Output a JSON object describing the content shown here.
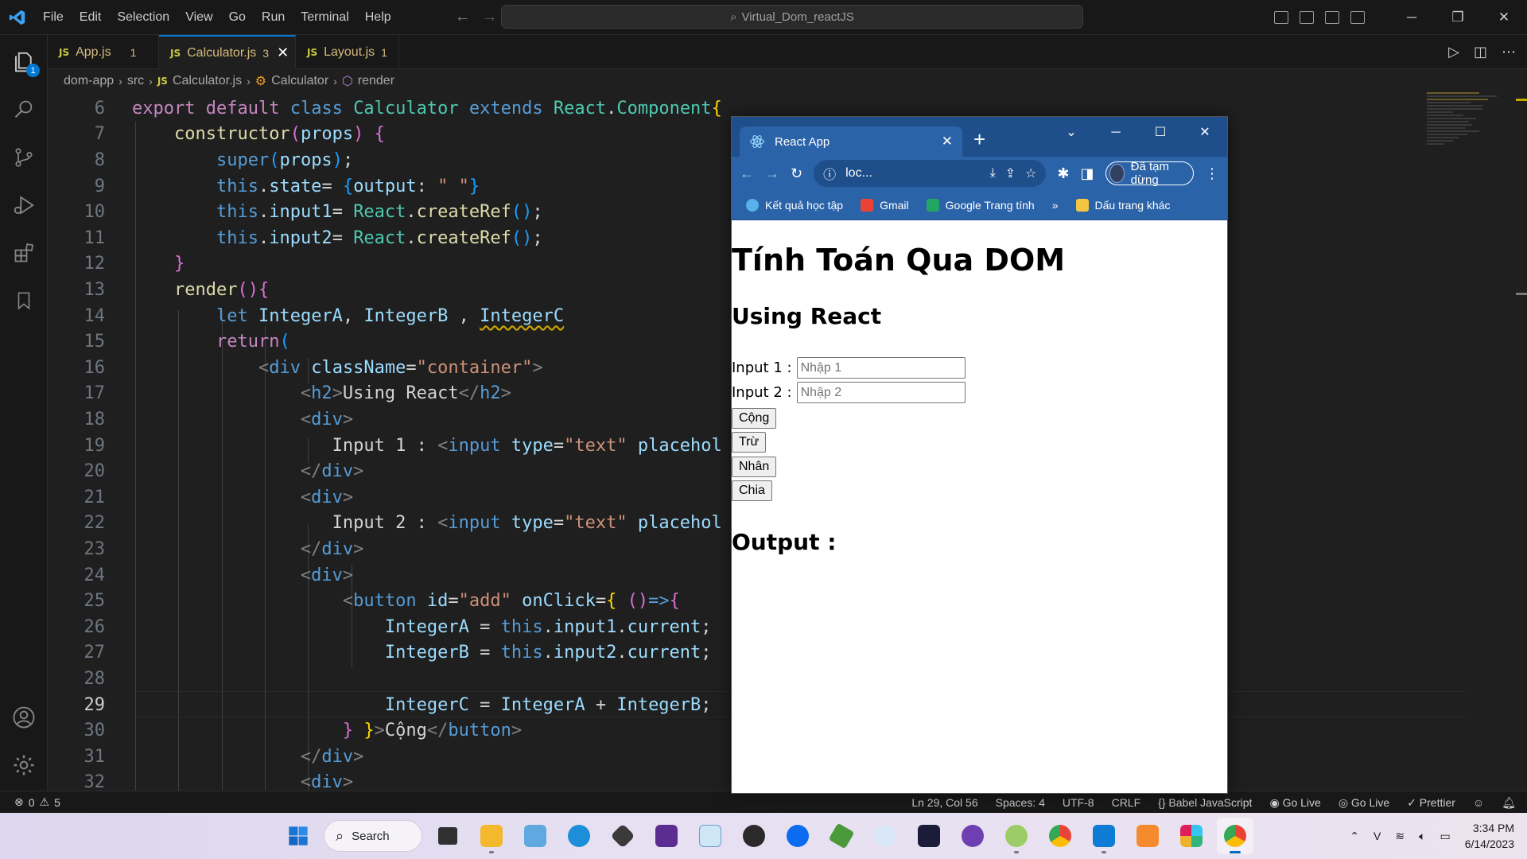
{
  "vscode": {
    "menu": [
      "File",
      "Edit",
      "Selection",
      "View",
      "Go",
      "Run",
      "Terminal",
      "Help"
    ],
    "search_text": "Virtual_Dom_reactJS",
    "explorer_badge": "1",
    "tabs": [
      {
        "label": "App.js",
        "badge": "JS",
        "count": "1",
        "modified": true,
        "active": false
      },
      {
        "label": "Calculator.js",
        "badge": "JS",
        "count": "3",
        "modified": false,
        "active": true
      },
      {
        "label": "Layout.js",
        "badge": "JS",
        "count": "1",
        "modified": false,
        "active": false
      }
    ],
    "breadcrumb": [
      "dom-app",
      "src",
      "Calculator.js",
      "Calculator",
      "render"
    ],
    "current_line": 29,
    "line_numbers": [
      "6",
      "7",
      "8",
      "9",
      "10",
      "11",
      "12",
      "13",
      "14",
      "15",
      "16",
      "17",
      "18",
      "19",
      "20",
      "21",
      "22",
      "23",
      "24",
      "25",
      "26",
      "27",
      "28",
      "29",
      "30",
      "31",
      "32"
    ],
    "status": {
      "errors": "0",
      "warnings": "5",
      "position": "Ln 29, Col 56",
      "spaces": "Spaces: 4",
      "encoding": "UTF-8",
      "eol": "CRLF",
      "language": "Babel JavaScript",
      "golive1": "Go Live",
      "golive2": "Go Live",
      "prettier": "Prettier"
    }
  },
  "code_text": {
    "l6_export": "export",
    "l6_default": "default",
    "l6_class": "class",
    "l6_name": "Calculator",
    "l6_extends": "extends",
    "l6_react": "React",
    "l6_component": "Component",
    "l7_constructor": "constructor",
    "l7_props": "props",
    "l8_super": "super",
    "l8_props": "props",
    "l9_this": "this",
    "l9_state": "state",
    "l9_output": "output",
    "l9_str": "\" \"",
    "l10_this": "this",
    "l10_input": "input1",
    "l10_react": "React",
    "l10_fn": "createRef",
    "l11_this": "this",
    "l11_input": "input2",
    "l11_react": "React",
    "l11_fn": "createRef",
    "l13_render": "render",
    "l14_let": "let",
    "l14_a": "IntegerA",
    "l14_b": "IntegerB",
    "l14_c": "IntegerC",
    "l15_return": "return",
    "l16_tag": "div",
    "l16_attr": "className",
    "l16_val": "\"container\"",
    "l17_tag": "h2",
    "l17_text": "Using React",
    "l18_tag": "div",
    "l19_text": "Input 1 : ",
    "l19_tag": "input",
    "l19_attr": "type",
    "l19_val": "\"text\"",
    "l19_attr2": "placehol",
    "l20_tag": "div",
    "l21_tag": "div",
    "l22_text": "Input 2 : ",
    "l22_tag": "input",
    "l22_attr": "type",
    "l22_val": "\"text\"",
    "l22_attr2": "placehol",
    "l23_tag": "div",
    "l24_tag": "div",
    "l25_tag": "button",
    "l25_attr": "id",
    "l25_val": "\"add\"",
    "l25_attr2": "onClick",
    "l26_a": "IntegerA",
    "l26_this": "this",
    "l26_input": "input1",
    "l26_cur": "current",
    "l27_b": "IntegerB",
    "l27_this": "this",
    "l27_input": "input2",
    "l27_cur": "current",
    "l29_c": "IntegerC",
    "l29_a": "IntegerA",
    "l29_b": "IntegerB",
    "l30_text": "Cộng",
    "l30_tag": "button",
    "l31_tag": "div",
    "l32_tag": "div"
  },
  "chrome": {
    "tab_title": "React App",
    "url": "loc...",
    "profile": "Đã tạm dừng",
    "bookmarks": [
      "Kết quả học tập",
      "Gmail",
      "Google Trang tính"
    ],
    "bookmarks_more": "»",
    "other_bookmarks": "Dấu trang khác",
    "page": {
      "h1": "Tính Toán Qua DOM",
      "h2": "Using React",
      "input1_label": "Input 1 :",
      "input1_placeholder": "Nhập 1",
      "input2_label": "Input 2 :",
      "input2_placeholder": "Nhập 2",
      "buttons": [
        "Cộng",
        "Trừ",
        "Nhân",
        "Chia"
      ],
      "output_label": "Output :"
    }
  },
  "taskbar": {
    "search_label": "Search",
    "time": "3:34 PM",
    "date": "6/14/2023"
  }
}
